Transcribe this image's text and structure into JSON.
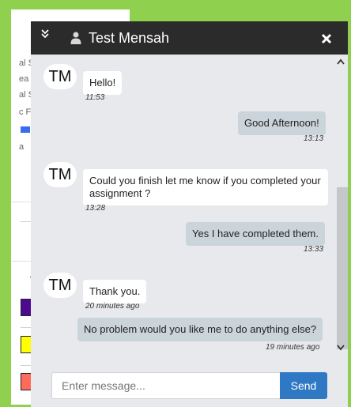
{
  "background_page": {
    "labels": [
      "al S",
      "ea",
      "al S",
      "c F",
      "a"
    ],
    "column_label": "ol",
    "swatch_colors": [
      "#4b0a8f",
      "#ffff00",
      "#ff6b5a"
    ]
  },
  "chat": {
    "title": "Test Mensah",
    "icons": {
      "collapse": "double-chevron-down-icon",
      "user": "user-icon",
      "close": "close-icon",
      "scroll_up": "chevron-up-icon",
      "scroll_down": "chevron-down-icon"
    },
    "messages": [
      {
        "direction": "incoming",
        "avatar": "TM",
        "text": "Hello!",
        "time": "11:53"
      },
      {
        "direction": "outgoing",
        "text": "Good Afternoon!",
        "time": "13:13"
      },
      {
        "direction": "incoming",
        "avatar": "TM",
        "text": "Could you finish let me know if you completed your assignment ?",
        "time": "13:28"
      },
      {
        "direction": "outgoing",
        "text": "Yes I have completed them.",
        "time": "13:33"
      },
      {
        "direction": "incoming",
        "avatar": "TM",
        "text": "Thank you.",
        "time": "20 minutes ago"
      },
      {
        "direction": "outgoing",
        "text": "No problem would you like me to do anything else?",
        "time": "19 minutes ago"
      }
    ],
    "composer": {
      "placeholder": "Enter message...",
      "value": "",
      "send_label": "Send"
    },
    "colors": {
      "header": "#2b2b2b",
      "panel": "#e7e9ec",
      "outgoing_bubble": "#ccd4db",
      "incoming_bubble": "#ffffff",
      "send_button": "#2f78c4",
      "frame": "#8fd14f"
    }
  }
}
